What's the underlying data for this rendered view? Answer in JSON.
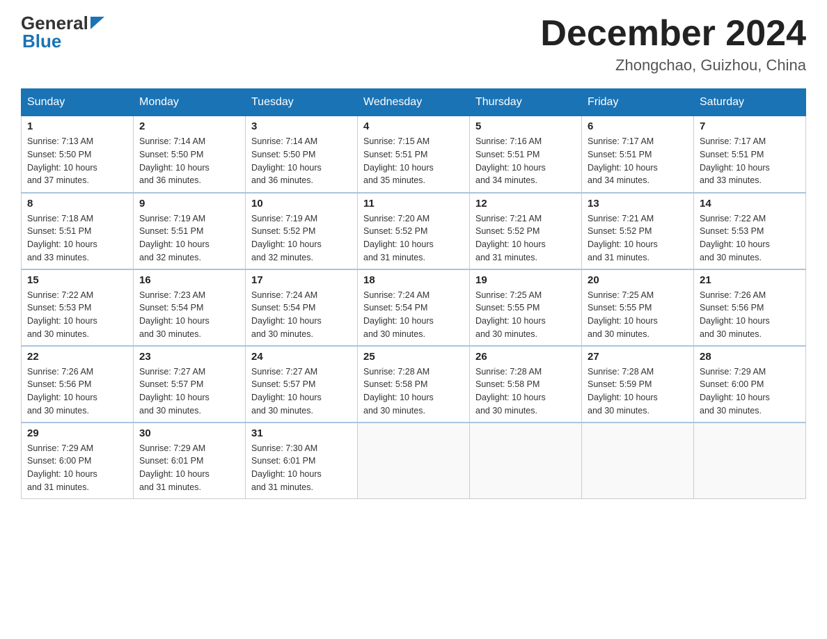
{
  "logo": {
    "general": "General",
    "blue": "Blue"
  },
  "title": "December 2024",
  "location": "Zhongchao, Guizhou, China",
  "headers": [
    "Sunday",
    "Monday",
    "Tuesday",
    "Wednesday",
    "Thursday",
    "Friday",
    "Saturday"
  ],
  "weeks": [
    [
      {
        "day": "1",
        "sunrise": "7:13 AM",
        "sunset": "5:50 PM",
        "daylight": "10 hours and 37 minutes."
      },
      {
        "day": "2",
        "sunrise": "7:14 AM",
        "sunset": "5:50 PM",
        "daylight": "10 hours and 36 minutes."
      },
      {
        "day": "3",
        "sunrise": "7:14 AM",
        "sunset": "5:50 PM",
        "daylight": "10 hours and 36 minutes."
      },
      {
        "day": "4",
        "sunrise": "7:15 AM",
        "sunset": "5:51 PM",
        "daylight": "10 hours and 35 minutes."
      },
      {
        "day": "5",
        "sunrise": "7:16 AM",
        "sunset": "5:51 PM",
        "daylight": "10 hours and 34 minutes."
      },
      {
        "day": "6",
        "sunrise": "7:17 AM",
        "sunset": "5:51 PM",
        "daylight": "10 hours and 34 minutes."
      },
      {
        "day": "7",
        "sunrise": "7:17 AM",
        "sunset": "5:51 PM",
        "daylight": "10 hours and 33 minutes."
      }
    ],
    [
      {
        "day": "8",
        "sunrise": "7:18 AM",
        "sunset": "5:51 PM",
        "daylight": "10 hours and 33 minutes."
      },
      {
        "day": "9",
        "sunrise": "7:19 AM",
        "sunset": "5:51 PM",
        "daylight": "10 hours and 32 minutes."
      },
      {
        "day": "10",
        "sunrise": "7:19 AM",
        "sunset": "5:52 PM",
        "daylight": "10 hours and 32 minutes."
      },
      {
        "day": "11",
        "sunrise": "7:20 AM",
        "sunset": "5:52 PM",
        "daylight": "10 hours and 31 minutes."
      },
      {
        "day": "12",
        "sunrise": "7:21 AM",
        "sunset": "5:52 PM",
        "daylight": "10 hours and 31 minutes."
      },
      {
        "day": "13",
        "sunrise": "7:21 AM",
        "sunset": "5:52 PM",
        "daylight": "10 hours and 31 minutes."
      },
      {
        "day": "14",
        "sunrise": "7:22 AM",
        "sunset": "5:53 PM",
        "daylight": "10 hours and 30 minutes."
      }
    ],
    [
      {
        "day": "15",
        "sunrise": "7:22 AM",
        "sunset": "5:53 PM",
        "daylight": "10 hours and 30 minutes."
      },
      {
        "day": "16",
        "sunrise": "7:23 AM",
        "sunset": "5:54 PM",
        "daylight": "10 hours and 30 minutes."
      },
      {
        "day": "17",
        "sunrise": "7:24 AM",
        "sunset": "5:54 PM",
        "daylight": "10 hours and 30 minutes."
      },
      {
        "day": "18",
        "sunrise": "7:24 AM",
        "sunset": "5:54 PM",
        "daylight": "10 hours and 30 minutes."
      },
      {
        "day": "19",
        "sunrise": "7:25 AM",
        "sunset": "5:55 PM",
        "daylight": "10 hours and 30 minutes."
      },
      {
        "day": "20",
        "sunrise": "7:25 AM",
        "sunset": "5:55 PM",
        "daylight": "10 hours and 30 minutes."
      },
      {
        "day": "21",
        "sunrise": "7:26 AM",
        "sunset": "5:56 PM",
        "daylight": "10 hours and 30 minutes."
      }
    ],
    [
      {
        "day": "22",
        "sunrise": "7:26 AM",
        "sunset": "5:56 PM",
        "daylight": "10 hours and 30 minutes."
      },
      {
        "day": "23",
        "sunrise": "7:27 AM",
        "sunset": "5:57 PM",
        "daylight": "10 hours and 30 minutes."
      },
      {
        "day": "24",
        "sunrise": "7:27 AM",
        "sunset": "5:57 PM",
        "daylight": "10 hours and 30 minutes."
      },
      {
        "day": "25",
        "sunrise": "7:28 AM",
        "sunset": "5:58 PM",
        "daylight": "10 hours and 30 minutes."
      },
      {
        "day": "26",
        "sunrise": "7:28 AM",
        "sunset": "5:58 PM",
        "daylight": "10 hours and 30 minutes."
      },
      {
        "day": "27",
        "sunrise": "7:28 AM",
        "sunset": "5:59 PM",
        "daylight": "10 hours and 30 minutes."
      },
      {
        "day": "28",
        "sunrise": "7:29 AM",
        "sunset": "6:00 PM",
        "daylight": "10 hours and 30 minutes."
      }
    ],
    [
      {
        "day": "29",
        "sunrise": "7:29 AM",
        "sunset": "6:00 PM",
        "daylight": "10 hours and 31 minutes."
      },
      {
        "day": "30",
        "sunrise": "7:29 AM",
        "sunset": "6:01 PM",
        "daylight": "10 hours and 31 minutes."
      },
      {
        "day": "31",
        "sunrise": "7:30 AM",
        "sunset": "6:01 PM",
        "daylight": "10 hours and 31 minutes."
      },
      null,
      null,
      null,
      null
    ]
  ],
  "labels": {
    "sunrise": "Sunrise:",
    "sunset": "Sunset:",
    "daylight": "Daylight:"
  }
}
